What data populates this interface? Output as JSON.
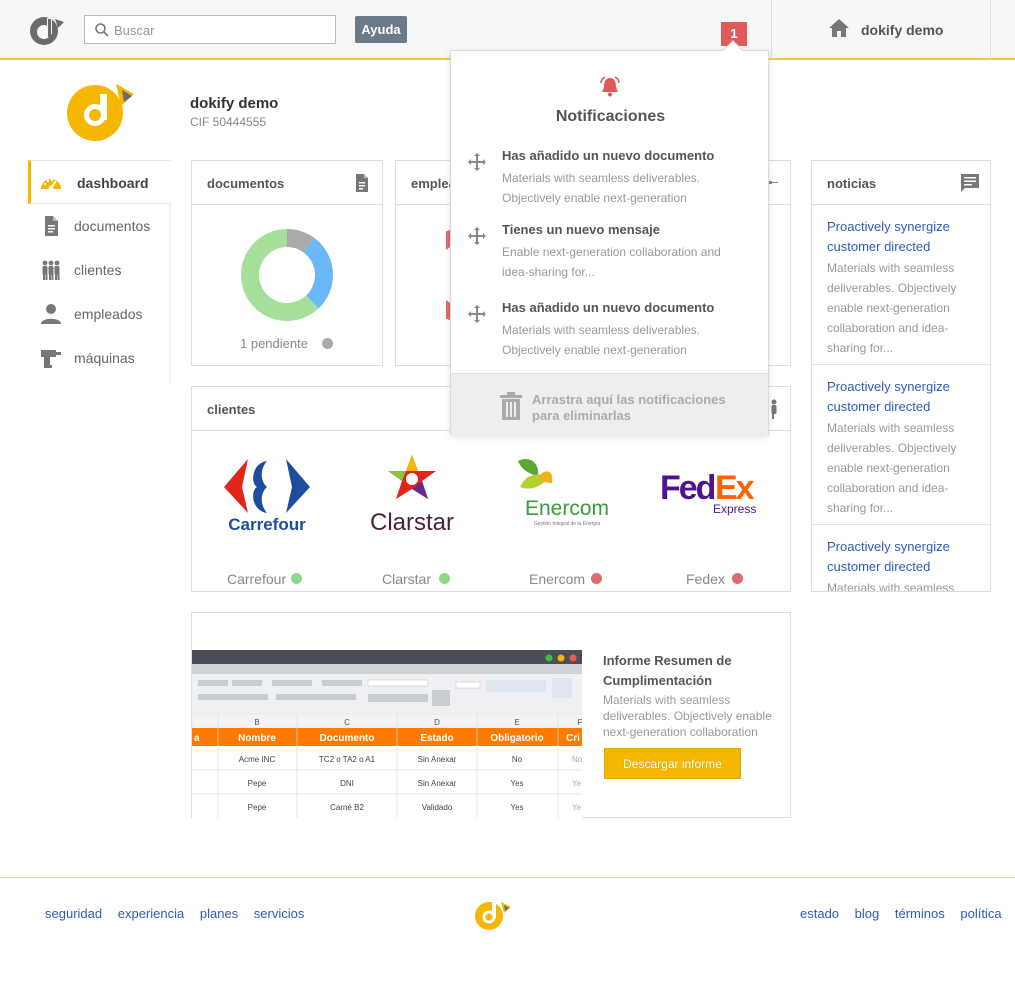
{
  "topbar": {
    "search_placeholder": "Buscar",
    "help_label": "Ayuda",
    "notification_count": "1",
    "company_name": "dokify demo"
  },
  "company": {
    "name": "dokify demo",
    "cif": "CIF 50444555"
  },
  "sidebar": {
    "items": [
      {
        "label": "dashboard",
        "icon": "dashboard-icon",
        "active": true
      },
      {
        "label": "documentos",
        "icon": "document-icon"
      },
      {
        "label": "clientes",
        "icon": "people-icon"
      },
      {
        "label": "empleados",
        "icon": "person-icon"
      },
      {
        "label": "máquinas",
        "icon": "drill-icon"
      }
    ]
  },
  "documents_panel": {
    "title": "documentos",
    "pending_label": "1 pendiente",
    "donut": {
      "green": 0.62,
      "blue": 0.28,
      "gray": 0.1
    }
  },
  "employees_panel": {
    "title": "empleados"
  },
  "clients_panel": {
    "title": "clientes",
    "clients": [
      {
        "name": "Carrefour",
        "status": "ok"
      },
      {
        "name": "Clarstar",
        "status": "ok"
      },
      {
        "name": "Enercom",
        "status": "error"
      },
      {
        "name": "Fedex",
        "status": "error"
      }
    ],
    "logos": {
      "carrefour": "Carrefour",
      "clarstar": "Clarstar",
      "enercom": "Enercom",
      "enercom_sub": "Gestión Integral de la Energía",
      "fedex_fed": "Fed",
      "fedex_ex": "Ex",
      "fedex_express": "Express"
    }
  },
  "news_panel": {
    "title": "noticias",
    "items": [
      {
        "link": "Proactively synergize customer directed",
        "text": "Materials with seamless deliverables. Objectively enable next-generation collaboration and idea-sharing for..."
      },
      {
        "link": "Proactively synergize customer directed",
        "text": "Materials with seamless deliverables. Objectively enable next-generation collaboration and idea-sharing for..."
      },
      {
        "link": "Proactively synergize customer directed",
        "text": "Materials with seamless"
      }
    ]
  },
  "report": {
    "title": "Informe Resumen de Cumplimentación",
    "description": "Materials with seamless deliverables. Objectively enable next-generation collaboration",
    "button": "Descargar informe",
    "sheet": {
      "columns": [
        "B",
        "C",
        "D",
        "E",
        "F"
      ],
      "headers": [
        "a",
        "Nombre",
        "Documento",
        "Estado",
        "Obligatorio",
        "Cri"
      ],
      "rows": [
        [
          "Acme INC",
          "TC2 o TA2 o A1",
          "Sin Anexar",
          "No",
          "No"
        ],
        [
          "Pepe",
          "DNI",
          "Sin Anexar",
          "Yes",
          "Ye"
        ],
        [
          "Pepe",
          "Carné B2",
          "Validado",
          "Yes",
          "Ye"
        ]
      ]
    }
  },
  "notifications": {
    "title": "Notificaciones",
    "items": [
      {
        "title": "Has añadido un nuevo documento",
        "body": "Materials with seamless deliverables. Objectively enable next-generation"
      },
      {
        "title": "Tienes un nuevo mensaje",
        "body": "Enable next-generation collaboration and idea-sharing for..."
      },
      {
        "title": "Has añadido un nuevo documento",
        "body": "Materials with seamless deliverables. Objectively enable next-generation"
      }
    ],
    "trash_text": "Arrastra aquí las notificaciones para eliminarlas"
  },
  "footer": {
    "left_links": [
      "seguridad",
      "experiencia",
      "planes",
      "servicios"
    ],
    "right_links": [
      "estado",
      "blog",
      "términos",
      "política"
    ]
  },
  "colors": {
    "accent": "#f5b700",
    "link": "#2b5dbb",
    "ok": "#8fd88a",
    "error": "#e06a6a",
    "pending_gray": "#aaaaaa"
  }
}
